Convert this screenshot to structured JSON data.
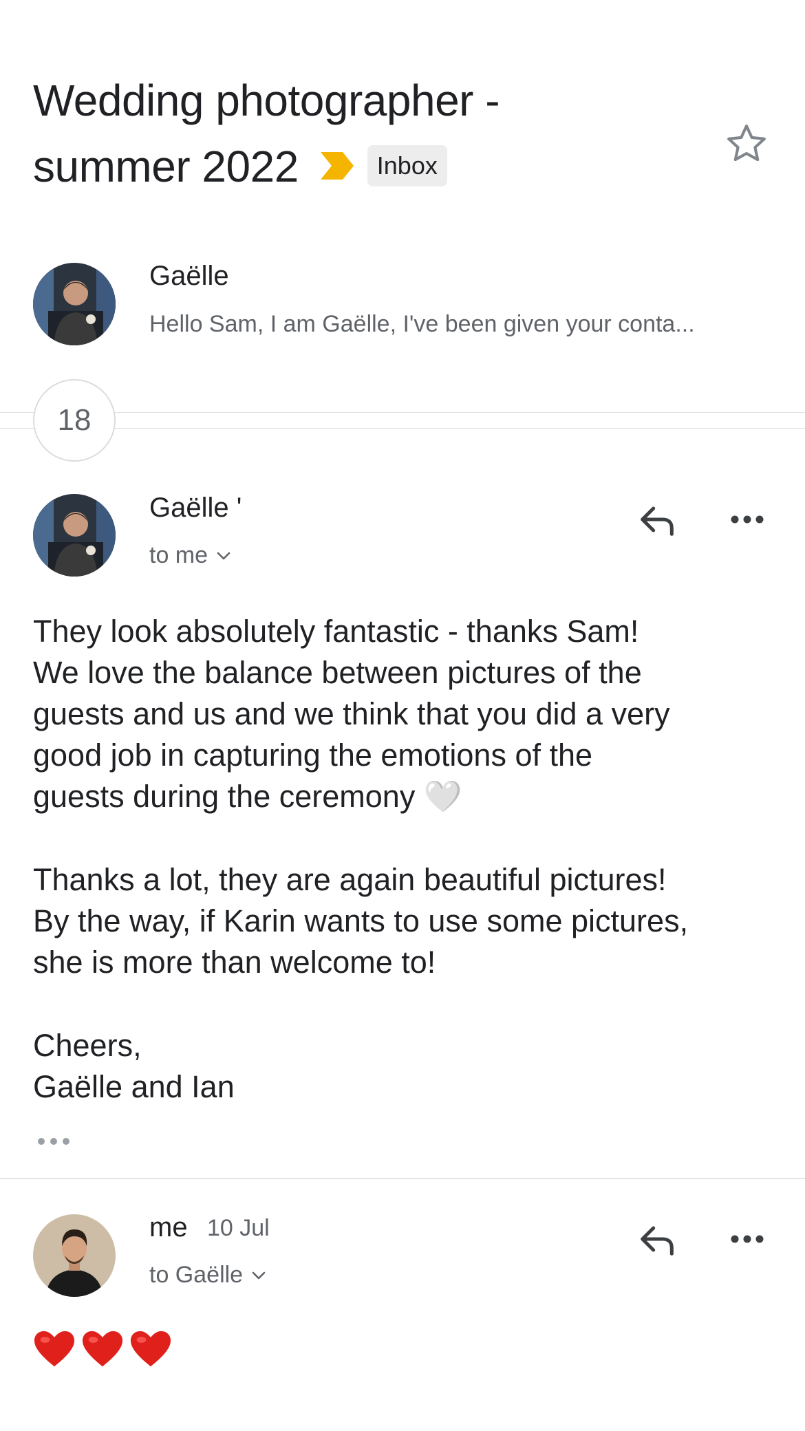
{
  "thread": {
    "subject_line1": "Wedding photographer -",
    "subject_line2": "summer 2022",
    "label": "Inbox",
    "importance_color": "#F4B400",
    "star_icon": "star-outline-icon"
  },
  "collapsed_message": {
    "sender": "Gaëlle",
    "snippet": "Hello Sam, I am Gaëlle, I've been given your conta..."
  },
  "hidden_count": "18",
  "message1": {
    "sender": "Gaëlle '",
    "recipient": "to me",
    "body_p1": "They look absolutely fantastic - thanks Sam!\nWe love the balance between pictures of the\nguests and us and we think that you did a very\ngood job in capturing the emotions of the\nguests during the ceremony",
    "body_emoji": "🤍",
    "body_p2": "Thanks a lot, they are again beautiful pictures!\nBy the way, if Karin wants to use some pictures,\nshe is more than welcome to!",
    "body_p3": "Cheers,\nGaëlle and Ian"
  },
  "message2": {
    "sender": "me",
    "date": "10 Jul",
    "recipient": "to Gaëlle",
    "body": "❤️❤️❤️"
  },
  "colors": {
    "text_primary": "#202124",
    "text_secondary": "#5f6368",
    "chip_bg": "#ededed",
    "heart_red": "#E0201B"
  }
}
